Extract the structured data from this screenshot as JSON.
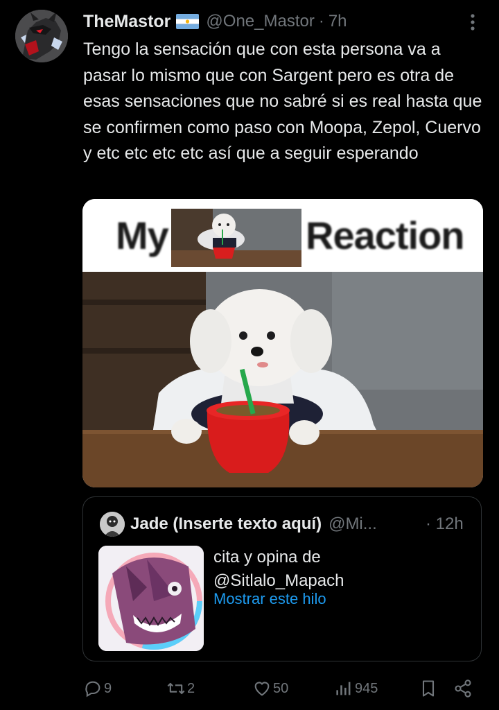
{
  "tweet": {
    "display_name": "TheMastor",
    "flag_icon": "argentina-flag",
    "handle": "@One_Mastor",
    "separator": "·",
    "time": "7h",
    "more_icon": "more-vertical-icon",
    "text": "Tengo la sensación que con esta persona va a pasar lo mismo que con Sargent pero es otra de esas sensaciones que no sabré si es real hasta que se confirmen como paso con Moopa, Zepol, Cuervo y etc etc etc etc así que a seguir esperando"
  },
  "media": {
    "word_left": "My",
    "word_right": "Reaction"
  },
  "quote": {
    "display_name": "Jade (Inserte texto aquí)",
    "handle": "@Mi...",
    "separator": "·",
    "time": "12h",
    "text_line1": "cita y opina de",
    "text_line2": "@Sitlalo_Mapach",
    "show_thread": "Mostrar este hilo"
  },
  "actions": {
    "reply_count": "9",
    "retweet_count": "2",
    "like_count": "50",
    "views_count": "945",
    "icons": [
      "reply-icon",
      "retweet-icon",
      "like-icon",
      "views-icon",
      "bookmark-icon",
      "share-icon"
    ]
  },
  "colors": {
    "background": "#000000",
    "text": "#e7e9ea",
    "muted": "#71767b",
    "link": "#1d9bf0",
    "border": "#2f3336"
  }
}
